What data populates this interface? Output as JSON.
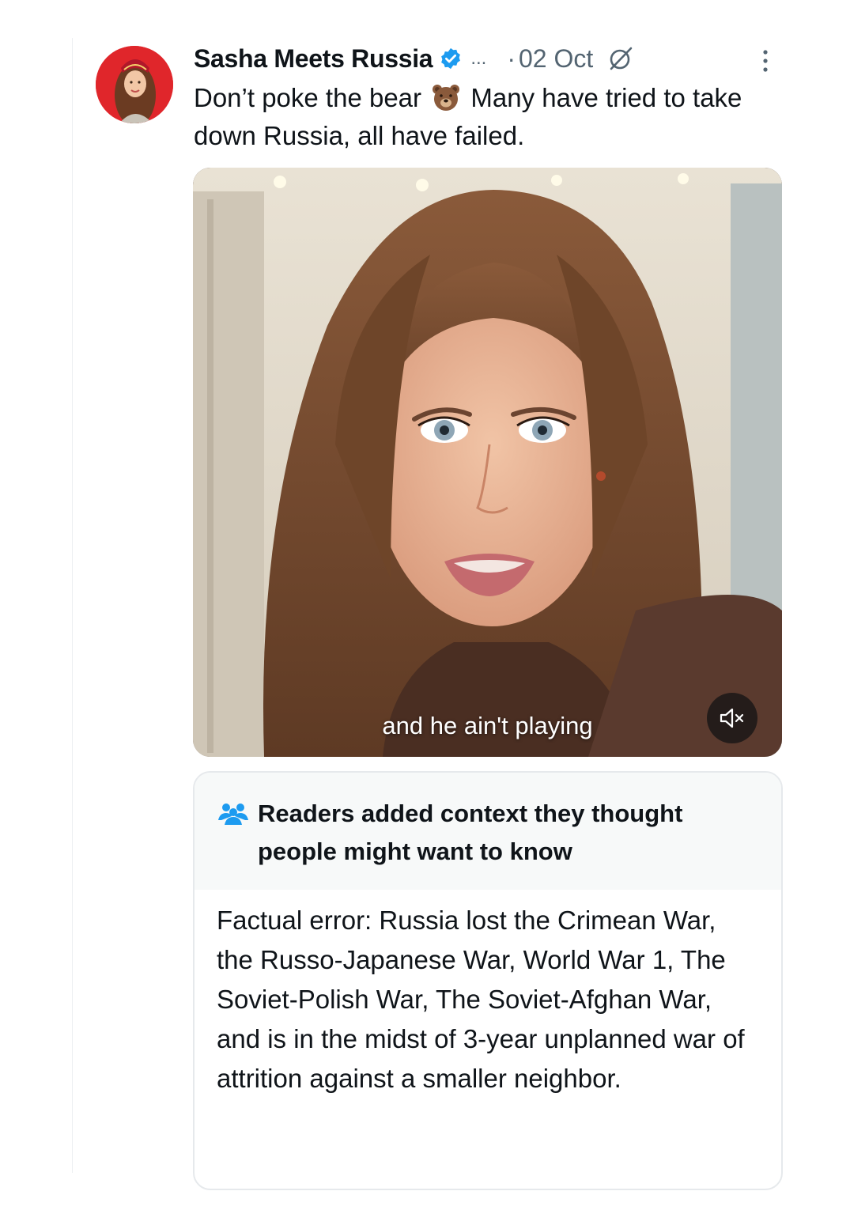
{
  "tweet": {
    "author_name": "Sasha Meets Russia",
    "handle_truncated": "...",
    "separator": "·",
    "date": "02 Oct",
    "text_before_emoji": "Don’t poke the bear",
    "emoji": "bear-face",
    "text_after_emoji": "Many have tried to take down Russia, all have failed.",
    "verified_color": "#1d9bf0"
  },
  "media": {
    "caption": "and he ain't playing",
    "mute_icon": "speaker-muted-icon"
  },
  "community_note": {
    "title": "Readers added context they thought people might want to know",
    "body": "Factual error: Russia lost the Crimean War, the Russo-Japanese War, World War 1, The Soviet-Polish War, The Soviet-Afghan War, and is in the midst of 3-year unplanned war of attrition against a smaller neighbor.",
    "icon_color": "#1d9bf0"
  }
}
